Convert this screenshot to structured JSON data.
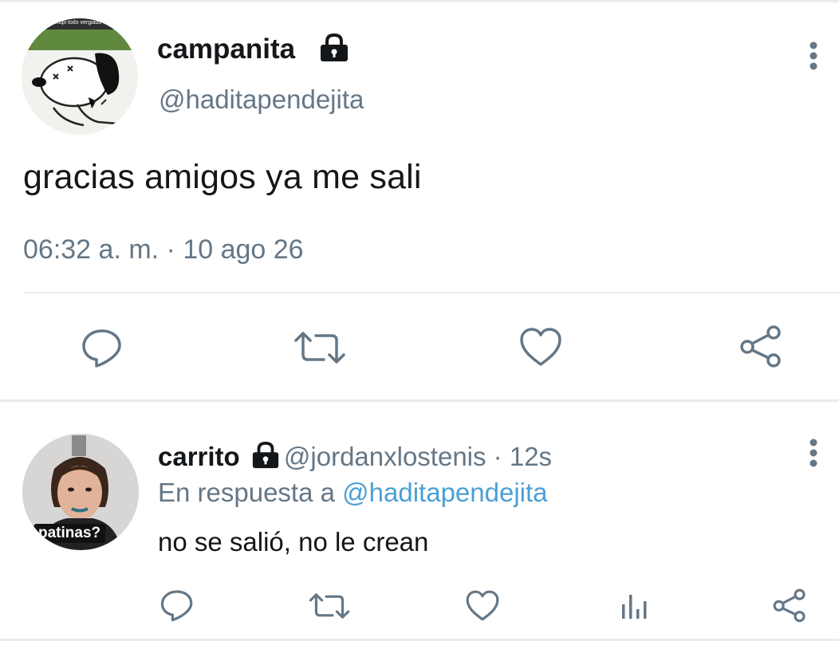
{
  "tweet": {
    "display_name": "campanita",
    "handle": "@haditapendejita",
    "avatar_caption": "el esnupi todo vergiado",
    "text": "gracias amigos ya me sali",
    "timestamp": "06:32 a. m. · 10 ago 26",
    "actions": [
      "reply-icon",
      "retweet-icon",
      "like-icon",
      "share-icon"
    ]
  },
  "reply": {
    "display_name": "carrito",
    "handle": "@jordanxlostenis",
    "separator": " · ",
    "time": "12s",
    "in_reply_prefix": "En respuesta a ",
    "in_reply_to": "@haditapendejita",
    "avatar_caption": "patinas?",
    "text": "no se salió, no le crean",
    "actions": [
      "reply-icon",
      "retweet-icon",
      "like-icon",
      "analytics-icon",
      "share-icon"
    ]
  },
  "colors": {
    "text": "#14171a",
    "secondary": "#657786",
    "link": "#4b9fd6",
    "divider": "#e6ecf0"
  }
}
